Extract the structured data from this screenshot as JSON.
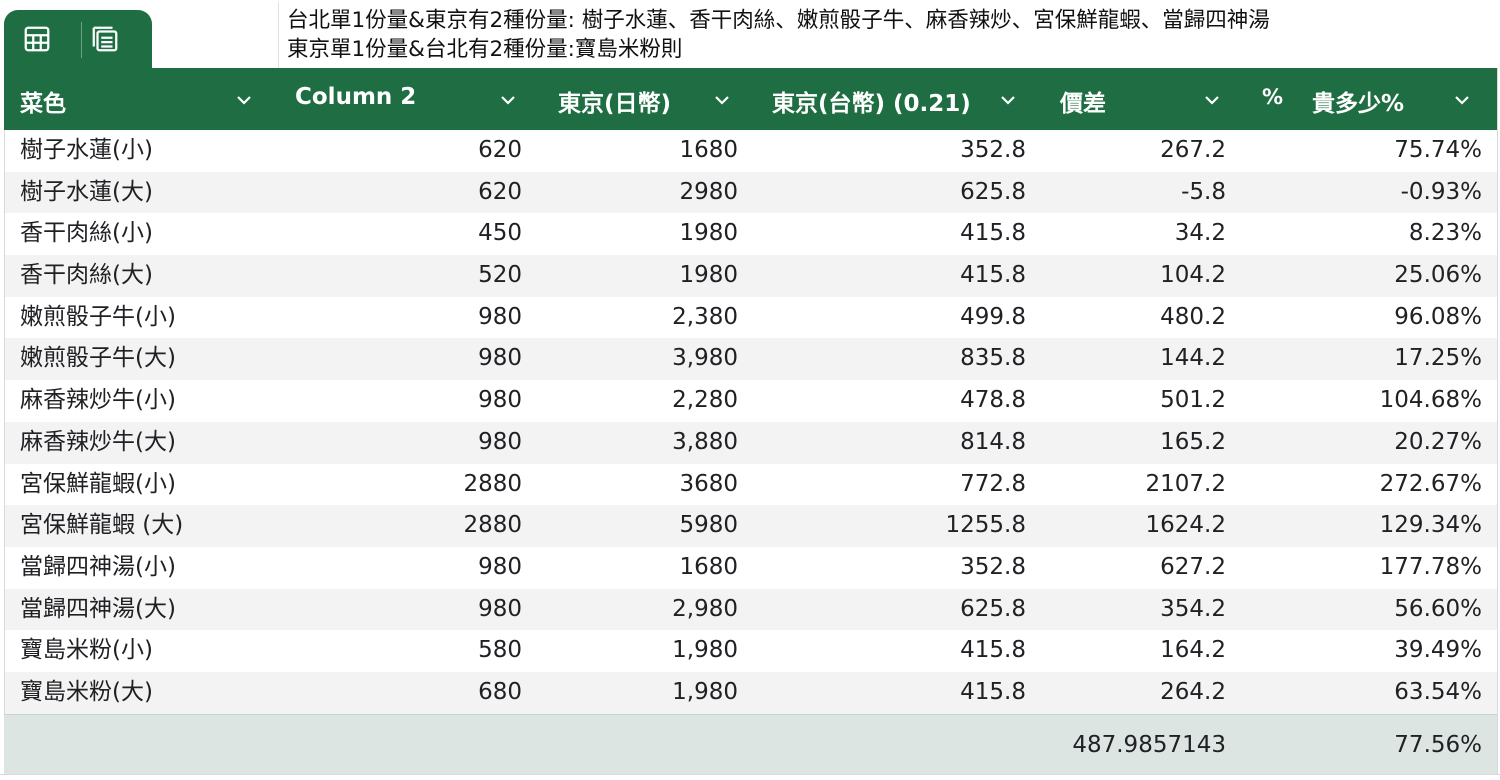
{
  "notes": {
    "line1": "台北單1份量&東京有2種份量: 樹子水蓮、香干肉絲、嫩煎骰子牛、麻香辣炒、宮保鮮龍蝦、當歸四神湯",
    "line2": "東京單1份量&台北有2種份量:寶島米粉則"
  },
  "view_tabs": [
    {
      "name": "table-view",
      "icon": "table-icon"
    },
    {
      "name": "card-view",
      "icon": "list-card-icon"
    }
  ],
  "columns": [
    {
      "label": "菜色",
      "icon": "chevron-down-icon"
    },
    {
      "label": "Column 2",
      "icon": "chevron-down-icon"
    },
    {
      "label": "東京(日幣)",
      "icon": "chevron-down-icon"
    },
    {
      "label": "東京(台幣) (0.21)",
      "icon": "chevron-down-icon"
    },
    {
      "label": "價差",
      "icon": "chevron-down-icon"
    },
    {
      "label": "貴多少%",
      "prefix": "%",
      "icon": "chevron-down-icon"
    }
  ],
  "rows": [
    {
      "dish": "樹子水蓮(小)",
      "col2": "620",
      "jpy": "1680",
      "twd": "352.8",
      "diff": "267.2",
      "pct": "75.74%"
    },
    {
      "dish": "樹子水蓮(大)",
      "col2": "620",
      "jpy": "2980",
      "twd": "625.8",
      "diff": "-5.8",
      "pct": "-0.93%"
    },
    {
      "dish": "香干肉絲(小)",
      "col2": "450",
      "jpy": "1980",
      "twd": "415.8",
      "diff": "34.2",
      "pct": "8.23%"
    },
    {
      "dish": "香干肉絲(大)",
      "col2": "520",
      "jpy": "1980",
      "twd": "415.8",
      "diff": "104.2",
      "pct": "25.06%"
    },
    {
      "dish": "嫩煎骰子牛(小)",
      "col2": "980",
      "jpy": "2,380",
      "twd": "499.8",
      "diff": "480.2",
      "pct": "96.08%"
    },
    {
      "dish": "嫩煎骰子牛(大)",
      "col2": "980",
      "jpy": "3,980",
      "twd": "835.8",
      "diff": "144.2",
      "pct": "17.25%"
    },
    {
      "dish": "麻香辣炒牛(小)",
      "col2": "980",
      "jpy": "2,280",
      "twd": "478.8",
      "diff": "501.2",
      "pct": "104.68%"
    },
    {
      "dish": "麻香辣炒牛(大)",
      "col2": "980",
      "jpy": "3,880",
      "twd": "814.8",
      "diff": "165.2",
      "pct": "20.27%"
    },
    {
      "dish": "宮保鮮龍蝦(小)",
      "col2": "2880",
      "jpy": "3680",
      "twd": "772.8",
      "diff": "2107.2",
      "pct": "272.67%"
    },
    {
      "dish": "宮保鮮龍蝦 (大)",
      "col2": "2880",
      "jpy": "5980",
      "twd": "1255.8",
      "diff": "1624.2",
      "pct": "129.34%"
    },
    {
      "dish": "當歸四神湯(小)",
      "col2": "980",
      "jpy": "1680",
      "twd": "352.8",
      "diff": "627.2",
      "pct": "177.78%"
    },
    {
      "dish": "當歸四神湯(大)",
      "col2": "980",
      "jpy": "2,980",
      "twd": "625.8",
      "diff": "354.2",
      "pct": "56.60%"
    },
    {
      "dish": "寶島米粉(小)",
      "col2": "580",
      "jpy": "1,980",
      "twd": "415.8",
      "diff": "164.2",
      "pct": "39.49%"
    },
    {
      "dish": "寶島米粉(大)",
      "col2": "680",
      "jpy": "1,980",
      "twd": "415.8",
      "diff": "264.2",
      "pct": "63.54%"
    }
  ],
  "totals": {
    "diff": "487.9857143",
    "pct": "77.56%"
  },
  "colors": {
    "header_bg": "#1f6e43",
    "header_text": "#ffffff",
    "alt_row": "#f3f3f3",
    "total_bg": "#dde5e3"
  }
}
